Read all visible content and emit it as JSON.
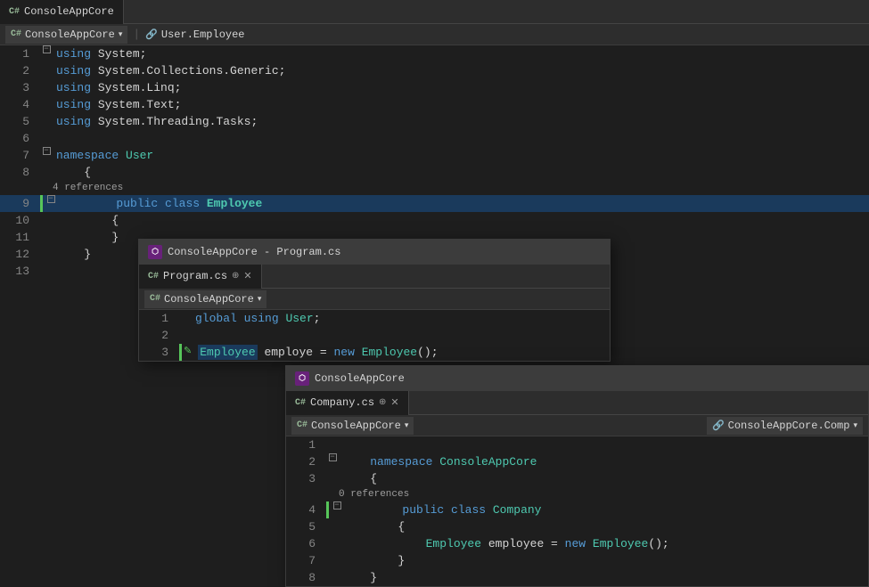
{
  "mainWindow": {
    "tab": "ConsoleAppCore",
    "breadcrumb": "User.Employee",
    "lines": [
      {
        "num": 1,
        "indent": 0,
        "tokens": [
          {
            "t": "collapse",
            "state": "collapsed"
          },
          {
            "t": "kw",
            "v": "using"
          },
          {
            "t": "plain",
            "v": " System;"
          }
        ],
        "gutter": "collapse"
      },
      {
        "num": 2,
        "indent": 0,
        "tokens": [
          {
            "t": "kw",
            "v": "using"
          },
          {
            "t": "plain",
            "v": " System.Collections.Generic;"
          }
        ]
      },
      {
        "num": 3,
        "indent": 0,
        "tokens": [
          {
            "t": "kw",
            "v": "using"
          },
          {
            "t": "plain",
            "v": " System.Linq;"
          }
        ]
      },
      {
        "num": 4,
        "indent": 0,
        "tokens": [
          {
            "t": "kw",
            "v": "using"
          },
          {
            "t": "plain",
            "v": " System.Text;"
          }
        ]
      },
      {
        "num": 5,
        "indent": 0,
        "tokens": [
          {
            "t": "kw",
            "v": "using"
          },
          {
            "t": "plain",
            "v": " System.Threading.Tasks;"
          }
        ]
      },
      {
        "num": 6,
        "indent": 0,
        "tokens": []
      },
      {
        "num": 7,
        "indent": 0,
        "tokens": [
          {
            "t": "collapse"
          },
          {
            "t": "kw",
            "v": "namespace"
          },
          {
            "t": "plain",
            "v": " "
          },
          {
            "t": "type",
            "v": "User"
          }
        ],
        "gutter": "collapse"
      },
      {
        "num": 8,
        "indent": 0,
        "tokens": [
          {
            "t": "plain",
            "v": "    {"
          }
        ]
      },
      {
        "num": 9,
        "indent": 1,
        "tokens": [
          {
            "t": "ref",
            "v": "4 references"
          },
          {
            "t": "collapse"
          },
          {
            "t": "kw",
            "v": "public"
          },
          {
            "t": "plain",
            "v": " "
          },
          {
            "t": "kw",
            "v": "class"
          },
          {
            "t": "plain",
            "v": " "
          },
          {
            "t": "kw-bold",
            "v": "Employee"
          }
        ],
        "gutter": "collapse",
        "highlight": true,
        "greenBar": true
      },
      {
        "num": 10,
        "indent": 1,
        "tokens": [
          {
            "t": "plain",
            "v": "        {"
          }
        ]
      },
      {
        "num": 11,
        "indent": 1,
        "tokens": [
          {
            "t": "plain",
            "v": "        }"
          }
        ]
      },
      {
        "num": 12,
        "indent": 0,
        "tokens": [
          {
            "t": "plain",
            "v": "    }"
          }
        ]
      },
      {
        "num": 13,
        "indent": 0,
        "tokens": []
      }
    ]
  },
  "programCsWindow": {
    "title": "ConsoleAppCore - Program.cs",
    "tab": "Program.cs",
    "dropdown": "ConsoleAppCore",
    "lines": [
      {
        "num": 1,
        "tokens": [
          {
            "t": "kw",
            "v": "global"
          },
          {
            "t": "plain",
            "v": " "
          },
          {
            "t": "kw",
            "v": "using"
          },
          {
            "t": "plain",
            "v": " "
          },
          {
            "t": "type",
            "v": "User"
          },
          {
            "t": "plain",
            "v": ";"
          }
        ]
      },
      {
        "num": 2,
        "tokens": []
      },
      {
        "num": 3,
        "tokens": [
          {
            "t": "type",
            "v": "Employee"
          },
          {
            "t": "plain",
            "v": " employe = "
          },
          {
            "t": "kw",
            "v": "new"
          },
          {
            "t": "plain",
            "v": " "
          },
          {
            "t": "type",
            "v": "Employee"
          },
          {
            "t": "plain",
            "v": "();"
          }
        ],
        "greenBar": true,
        "penIcon": true
      }
    ]
  },
  "companyWindow": {
    "title": "ConsoleAppCore",
    "tab": "Company.cs",
    "dropdown": "ConsoleAppCore",
    "dropdownRight": "ConsoleAppCore.Comp",
    "lines": [
      {
        "num": 1,
        "tokens": []
      },
      {
        "num": 2,
        "tokens": [
          {
            "t": "collapse"
          },
          {
            "t": "kw",
            "v": "namespace"
          },
          {
            "t": "plain",
            "v": " "
          },
          {
            "t": "type",
            "v": "ConsoleAppCore"
          }
        ],
        "gutter": "collapse"
      },
      {
        "num": 3,
        "tokens": [
          {
            "t": "plain",
            "v": "    {"
          }
        ]
      },
      {
        "num": 4,
        "tokens": [
          {
            "t": "ref",
            "v": "0 references"
          },
          {
            "t": "collapse"
          },
          {
            "t": "kw",
            "v": "public"
          },
          {
            "t": "plain",
            "v": " "
          },
          {
            "t": "kw",
            "v": "class"
          },
          {
            "t": "plain",
            "v": " "
          },
          {
            "t": "type",
            "v": "Company"
          }
        ],
        "gutter": "collapse",
        "greenBar": true
      },
      {
        "num": 5,
        "tokens": [
          {
            "t": "plain",
            "v": "        {"
          }
        ]
      },
      {
        "num": 6,
        "tokens": [
          {
            "t": "type",
            "v": "Employee"
          },
          {
            "t": "plain",
            "v": " employee = "
          },
          {
            "t": "kw",
            "v": "new"
          },
          {
            "t": "plain",
            "v": " "
          },
          {
            "t": "type",
            "v": "Employee"
          },
          {
            "t": "plain",
            "v": "();"
          }
        ]
      },
      {
        "num": 7,
        "tokens": [
          {
            "t": "plain",
            "v": "        }"
          }
        ]
      },
      {
        "num": 8,
        "tokens": [
          {
            "t": "plain",
            "v": "    }"
          }
        ]
      }
    ]
  },
  "icons": {
    "vs": "⬡",
    "close": "✕",
    "csharp": "C#",
    "chevron": "▾",
    "pin": "⊕",
    "penEdit": "✎"
  }
}
